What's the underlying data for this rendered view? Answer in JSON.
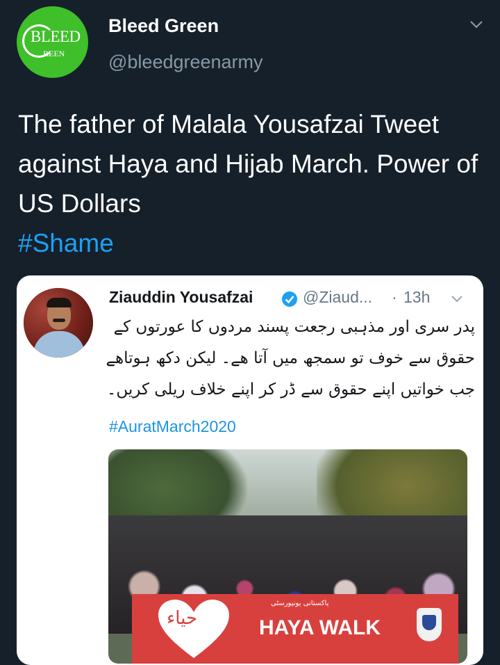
{
  "tweet": {
    "author_name": "Bleed Green",
    "author_handle": "@bleedgreenarmy",
    "avatar_logo_line1": "BLEED",
    "avatar_logo_line2": "REEN",
    "text": "The father of Malala Yousafzai Tweet against Haya and Hijab March. Power of US Dollars",
    "hashtag": "#Shame",
    "menu_icon": "chevron-down-icon"
  },
  "quoted_tweet": {
    "author_name": "Ziauddin Yousafzai",
    "verified_icon": "verified-badge-icon",
    "author_handle": "@Ziaud...",
    "separator": "·",
    "time": "13h",
    "text_urdu": "پدر سری اور مذہبی رجعت پسند مردوں کا عورتوں کے حقوق سے خوف تو سمجھ میں آتا ھے۔ لیکن دکھ ہوتاھے جب خواتیں اپنے حقوق سے ڈر کر اپنے خلاف ریلی کریں۔",
    "hashtag": "#AuratMarch2020",
    "image": {
      "banner_urdu": "حیاء",
      "banner_subtext": "پاکستانی یونیورسٹی",
      "banner_text": "HAYA WALK"
    }
  },
  "colors": {
    "background": "#15202b",
    "link": "#1da1f2",
    "secondary_text": "#8899a6",
    "avatar_green": "#3fbf2a",
    "banner_red": "#d8403e"
  }
}
